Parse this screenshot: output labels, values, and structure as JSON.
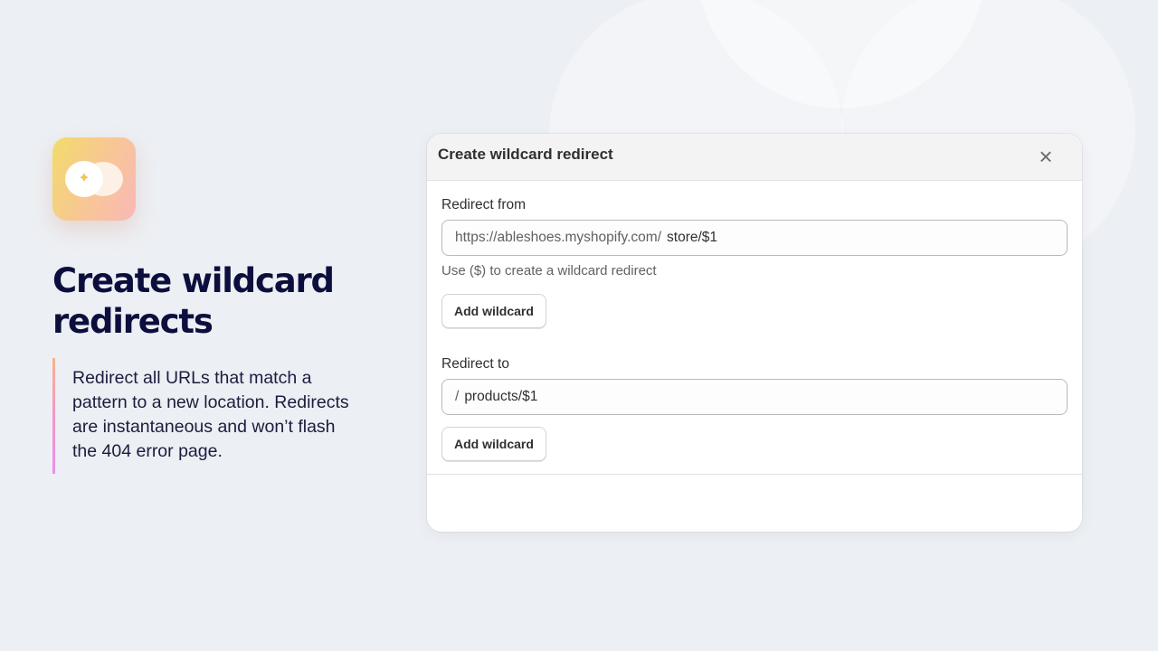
{
  "feature": {
    "title": "Create wildcard redirects",
    "description": "Redirect all URLs that match a pattern to a new location. Redirects are instantaneous and won’t flash the 404 error page."
  },
  "modal": {
    "title": "Create wildcard redirect",
    "close_icon": "×",
    "redirect_from": {
      "label": "Redirect from",
      "prefix": "https://ableshoes.myshopify.com/",
      "value": "store/$1",
      "help": "Use ($) to create a wildcard redirect",
      "button": "Add wildcard"
    },
    "redirect_to": {
      "label": "Redirect to",
      "prefix": "/",
      "value": "products/$1",
      "button": "Add wildcard"
    }
  },
  "icons": {
    "app": "sparkle-icon",
    "close": "close-icon"
  },
  "colors": {
    "heading": "#0c0f3d",
    "accent_gradient_start": "#f2dc6a",
    "accent_gradient_end": "#f9b8b8",
    "background": "#eceff3"
  }
}
